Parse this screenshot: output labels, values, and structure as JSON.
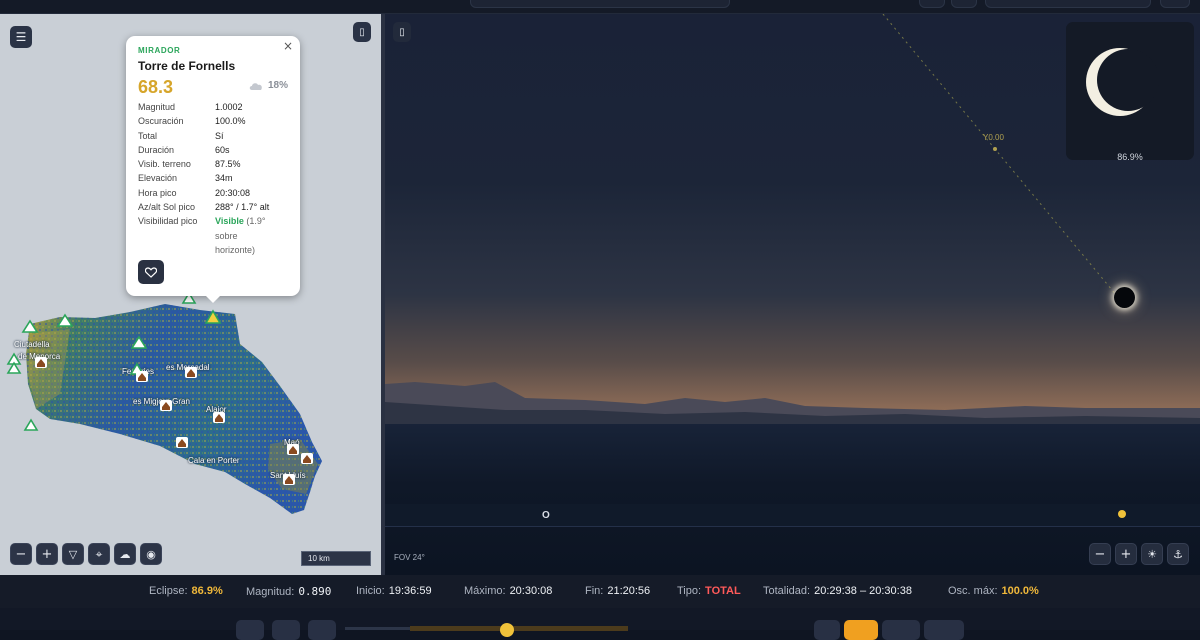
{
  "popup": {
    "kind": "MIRADOR",
    "name": "Torre de Fornells",
    "score": "68.3",
    "cloud": "18%",
    "close": "×",
    "rows": [
      {
        "k": "Magnitud",
        "v": "1.0002"
      },
      {
        "k": "Oscuración",
        "v": "100.0%"
      },
      {
        "k": "Total",
        "v": "Sí"
      },
      {
        "k": "Duración",
        "v": "60s"
      },
      {
        "k": "Visib. terreno",
        "v": "87.5%"
      },
      {
        "k": "Elevación",
        "v": "34m"
      },
      {
        "k": "Hora pico",
        "v": "20:30:08"
      },
      {
        "k": "Az/alt Sol pico",
        "v": "288° / 1.7° alt"
      }
    ],
    "visibility": {
      "k": "Visibilidad pico",
      "status": "Visible",
      "note1": "(1.9°",
      "note2": "sobre",
      "note3": "horizonte)"
    }
  },
  "map": {
    "scale_label": "10 km",
    "place_labels": [
      "Ciutadella",
      "de Menorca",
      "Ferreries",
      "es Mercadal",
      "es Migjorn Gran",
      "Alaior",
      "Maó",
      "Cala en Porter",
      "Sant Lluís"
    ]
  },
  "sky": {
    "fov": "FOV 24°",
    "path_label": "Y0.00",
    "horizon_marker": "O",
    "thumb_pct": "86.9%"
  },
  "status": {
    "eclipse_label": "Eclipse:",
    "eclipse_value": "86.9%",
    "magnitud_label": "Magnitud:",
    "magnitud_value": "0.890",
    "inicio_label": "Inicio:",
    "inicio_value": "19:36:59",
    "maximo_label": "Máximo:",
    "maximo_value": "20:30:08",
    "fin_label": "Fin:",
    "fin_value": "21:20:56",
    "tipo_label": "Tipo:",
    "tipo_value": "TOTAL",
    "totalidad_label": "Totalidad:",
    "totalidad_value": "20:29:38 – 20:30:38",
    "osc_label": "Osc. máx:",
    "osc_value": "100.0%"
  },
  "colors": {
    "accent": "#f0b83a",
    "visible": "#2aa55a",
    "total": "#ff5a5a"
  }
}
